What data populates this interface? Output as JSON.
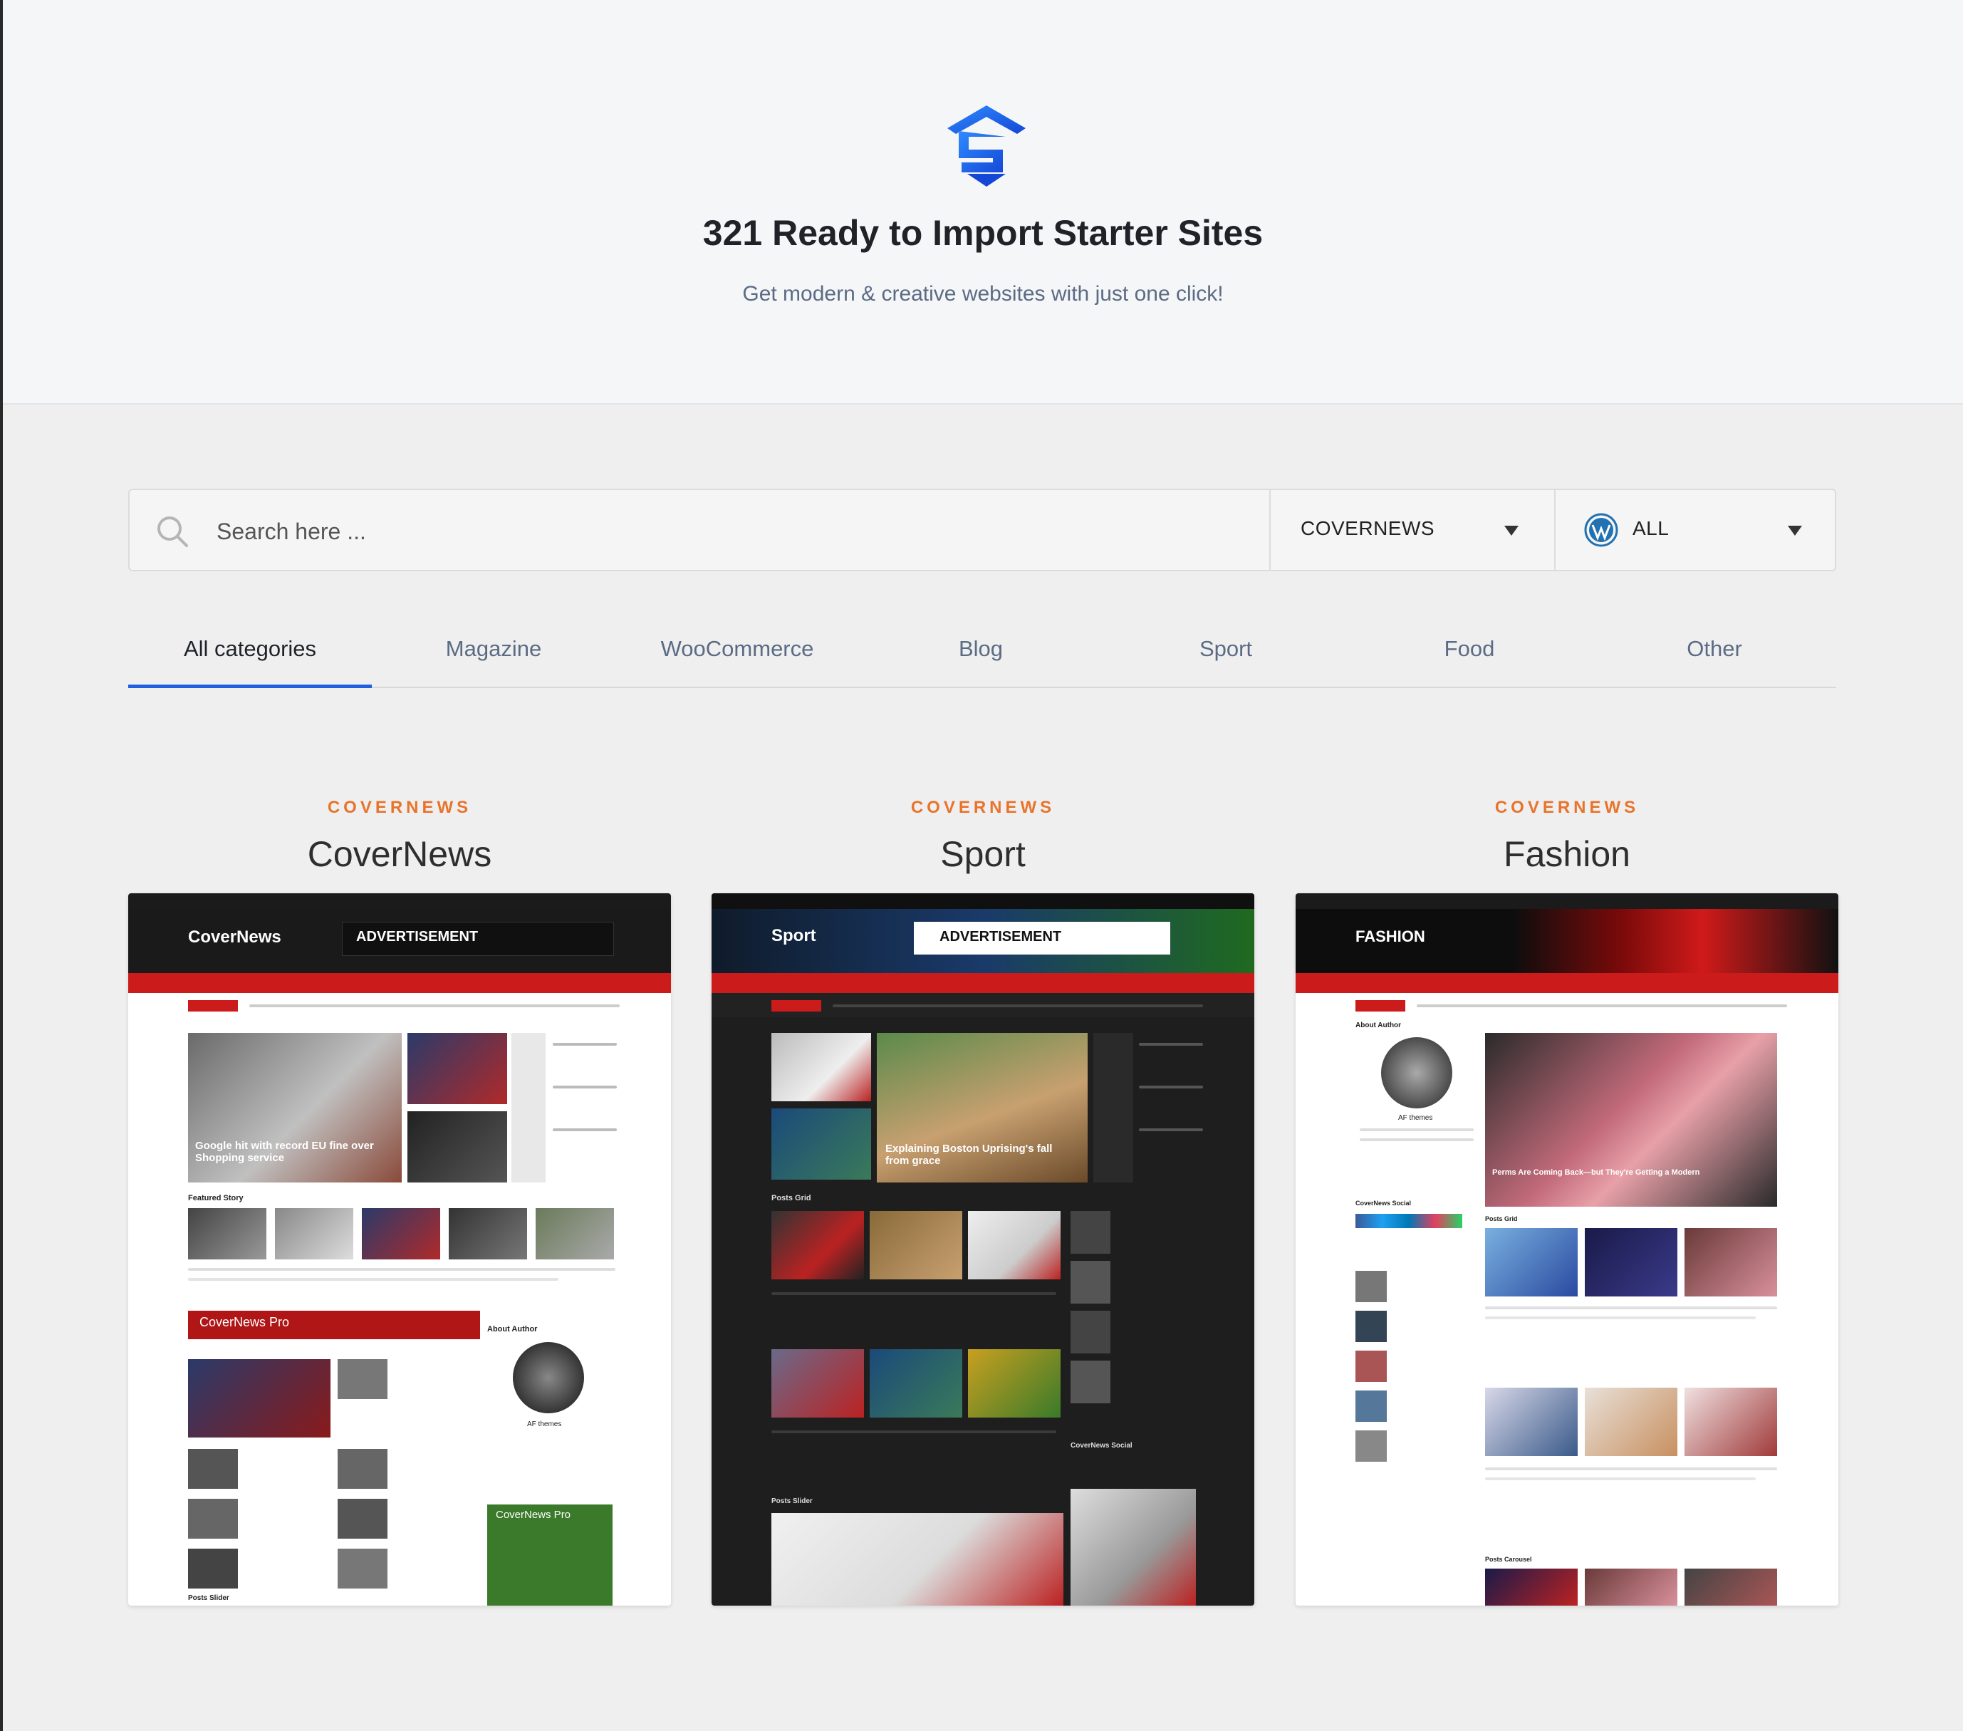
{
  "header": {
    "title": "321 Ready to Import Starter Sites",
    "subtitle": "Get modern & creative websites with just one click!"
  },
  "search": {
    "placeholder": "Search here ...",
    "theme_select": "COVERNEWS",
    "builder_select": "ALL"
  },
  "tabs": [
    {
      "label": "All categories",
      "active": true
    },
    {
      "label": "Magazine"
    },
    {
      "label": "WooCommerce"
    },
    {
      "label": "Blog"
    },
    {
      "label": "Sport"
    },
    {
      "label": "Food"
    },
    {
      "label": "Other"
    }
  ],
  "cards": [
    {
      "category": "COVERNEWS",
      "name": "CoverNews",
      "preview": {
        "brand": "CoverNews",
        "ad": "ADVERTISEMENT",
        "main_headline": "Google hit with record EU fine over Shopping service",
        "section_featured": "Featured Story",
        "promo": "CoverNews Pro",
        "promo2": "CoverNews Pro",
        "about": "About Author",
        "author": "AF themes",
        "slider": "Posts Slider"
      }
    },
    {
      "category": "COVERNEWS",
      "name": "Sport",
      "preview": {
        "brand": "Sport",
        "ad": "ADVERTISEMENT",
        "main_headline": "Explaining Boston Uprising's fall from grace",
        "grid": "Posts Grid",
        "slider": "Posts Slider",
        "social": "CoverNews Social"
      }
    },
    {
      "category": "COVERNEWS",
      "name": "Fashion",
      "preview": {
        "brand": "FASHION",
        "main_headline": "Perms Are Coming Back—but They're Getting a Modern",
        "about": "About Author",
        "author": "AF themes",
        "grid": "Posts Grid",
        "carousel": "Posts Carousel",
        "social": "CoverNews Social"
      }
    }
  ],
  "colors": {
    "accent_blue": "#1f5fe0",
    "category_orange": "#e8742c",
    "nav_red": "#cc1b1b"
  }
}
